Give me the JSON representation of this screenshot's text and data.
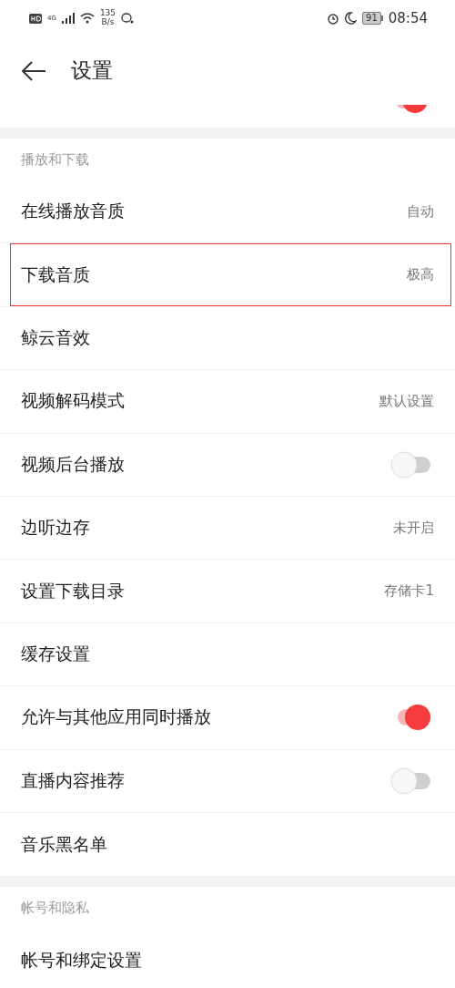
{
  "status_bar": {
    "net_type": "4G",
    "speed_value": "135",
    "speed_unit": "B/s",
    "battery": "91",
    "time": "08:54"
  },
  "header": {
    "title": "设置"
  },
  "top_partial_row": {
    "on": true
  },
  "sections": [
    {
      "title": "播放和下载",
      "rows": [
        {
          "kind": "value",
          "label": "在线播放音质",
          "value": "自动",
          "highlighted": false
        },
        {
          "kind": "value",
          "label": "下载音质",
          "value": "极高",
          "highlighted": true
        },
        {
          "kind": "plain",
          "label": "鲸云音效",
          "highlighted": false
        },
        {
          "kind": "value",
          "label": "视频解码模式",
          "value": "默认设置",
          "highlighted": false
        },
        {
          "kind": "toggle",
          "label": "视频后台播放",
          "on": false,
          "highlighted": false
        },
        {
          "kind": "value",
          "label": "边听边存",
          "value": "未开启",
          "highlighted": false
        },
        {
          "kind": "value",
          "label": "设置下载目录",
          "value": "存储卡1",
          "highlighted": false
        },
        {
          "kind": "plain",
          "label": "缓存设置",
          "highlighted": false
        },
        {
          "kind": "toggle",
          "label": "允许与其他应用同时播放",
          "on": true,
          "highlighted": false
        },
        {
          "kind": "toggle",
          "label": "直播内容推荐",
          "on": false,
          "highlighted": false
        },
        {
          "kind": "plain",
          "label": "音乐黑名单",
          "highlighted": false
        }
      ]
    },
    {
      "title": "帐号和隐私",
      "rows": [
        {
          "kind": "plain",
          "label": "帐号和绑定设置",
          "highlighted": false
        }
      ]
    }
  ]
}
